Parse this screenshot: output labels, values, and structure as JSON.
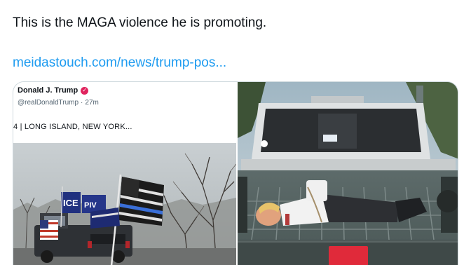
{
  "tweet": {
    "text": "This is the MAGA violence he is promoting.",
    "link": "meidastouch.com/news/trump-pos..."
  },
  "embedded_post": {
    "author_name": "Donald J. Trump",
    "handle": "@realDonaldTrump",
    "time": "27m",
    "caption": "4 | LONG ISLAND, NEW YORK...",
    "flag_text": "ICE",
    "flag_text_2": "PIV"
  },
  "colors": {
    "link": "#1d9bf0",
    "text": "#0f1419",
    "muted": "#536471",
    "verified_badge": "#e0245e"
  },
  "icons": {
    "verified": "verified-badge-icon"
  }
}
